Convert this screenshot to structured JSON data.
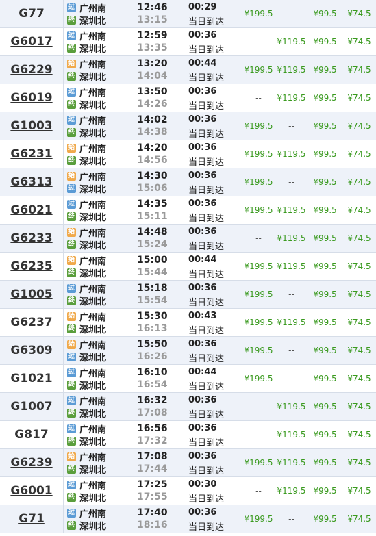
{
  "colors": {
    "row_alt": "#eef2f9",
    "price_green": "#3a9a1f",
    "arrival_grey": "#9a9a9a",
    "badge_pass": "#5b9bd5",
    "badge_start": "#f0a94b",
    "badge_end": "#5a9e3c"
  },
  "badges": {
    "pass": "过",
    "start": "始",
    "end": "终"
  },
  "trains": [
    {
      "no": "G77",
      "from": "广州南",
      "to": "深圳北",
      "from_type": "pass",
      "to_type": "end",
      "dep": "12:46",
      "arr": "13:15",
      "dur": "00:29",
      "note": "当日到达",
      "p1": "¥199.5",
      "p2": "--",
      "p3": "¥99.5",
      "p4": "¥74.5"
    },
    {
      "no": "G6017",
      "from": "广州南",
      "to": "深圳北",
      "from_type": "pass",
      "to_type": "end",
      "dep": "12:59",
      "arr": "13:35",
      "dur": "00:36",
      "note": "当日到达",
      "p1": "--",
      "p2": "¥119.5",
      "p3": "¥99.5",
      "p4": "¥74.5"
    },
    {
      "no": "G6229",
      "from": "广州南",
      "to": "深圳北",
      "from_type": "start",
      "to_type": "end",
      "dep": "13:20",
      "arr": "14:04",
      "dur": "00:44",
      "note": "当日到达",
      "p1": "¥199.5",
      "p2": "¥119.5",
      "p3": "¥99.5",
      "p4": "¥74.5"
    },
    {
      "no": "G6019",
      "from": "广州南",
      "to": "深圳北",
      "from_type": "pass",
      "to_type": "end",
      "dep": "13:50",
      "arr": "14:26",
      "dur": "00:36",
      "note": "当日到达",
      "p1": "--",
      "p2": "¥119.5",
      "p3": "¥99.5",
      "p4": "¥74.5"
    },
    {
      "no": "G1003",
      "from": "广州南",
      "to": "深圳北",
      "from_type": "pass",
      "to_type": "end",
      "dep": "14:02",
      "arr": "14:38",
      "dur": "00:36",
      "note": "当日到达",
      "p1": "¥199.5",
      "p2": "--",
      "p3": "¥99.5",
      "p4": "¥74.5"
    },
    {
      "no": "G6231",
      "from": "广州南",
      "to": "深圳北",
      "from_type": "start",
      "to_type": "end",
      "dep": "14:20",
      "arr": "14:56",
      "dur": "00:36",
      "note": "当日到达",
      "p1": "¥199.5",
      "p2": "¥119.5",
      "p3": "¥99.5",
      "p4": "¥74.5"
    },
    {
      "no": "G6313",
      "from": "广州南",
      "to": "深圳北",
      "from_type": "start",
      "to_type": "pass",
      "dep": "14:30",
      "arr": "15:06",
      "dur": "00:36",
      "note": "当日到达",
      "p1": "¥199.5",
      "p2": "--",
      "p3": "¥99.5",
      "p4": "¥74.5"
    },
    {
      "no": "G6021",
      "from": "广州南",
      "to": "深圳北",
      "from_type": "pass",
      "to_type": "end",
      "dep": "14:35",
      "arr": "15:11",
      "dur": "00:36",
      "note": "当日到达",
      "p1": "¥199.5",
      "p2": "¥119.5",
      "p3": "¥99.5",
      "p4": "¥74.5"
    },
    {
      "no": "G6233",
      "from": "广州南",
      "to": "深圳北",
      "from_type": "start",
      "to_type": "end",
      "dep": "14:48",
      "arr": "15:24",
      "dur": "00:36",
      "note": "当日到达",
      "p1": "--",
      "p2": "¥119.5",
      "p3": "¥99.5",
      "p4": "¥74.5"
    },
    {
      "no": "G6235",
      "from": "广州南",
      "to": "深圳北",
      "from_type": "start",
      "to_type": "end",
      "dep": "15:00",
      "arr": "15:44",
      "dur": "00:44",
      "note": "当日到达",
      "p1": "¥199.5",
      "p2": "¥119.5",
      "p3": "¥99.5",
      "p4": "¥74.5"
    },
    {
      "no": "G1005",
      "from": "广州南",
      "to": "深圳北",
      "from_type": "pass",
      "to_type": "end",
      "dep": "15:18",
      "arr": "15:54",
      "dur": "00:36",
      "note": "当日到达",
      "p1": "¥199.5",
      "p2": "--",
      "p3": "¥99.5",
      "p4": "¥74.5"
    },
    {
      "no": "G6237",
      "from": "广州南",
      "to": "深圳北",
      "from_type": "start",
      "to_type": "end",
      "dep": "15:30",
      "arr": "16:13",
      "dur": "00:43",
      "note": "当日到达",
      "p1": "¥199.5",
      "p2": "¥119.5",
      "p3": "¥99.5",
      "p4": "¥74.5"
    },
    {
      "no": "G6309",
      "from": "广州南",
      "to": "深圳北",
      "from_type": "start",
      "to_type": "pass",
      "dep": "15:50",
      "arr": "16:26",
      "dur": "00:36",
      "note": "当日到达",
      "p1": "¥199.5",
      "p2": "--",
      "p3": "¥99.5",
      "p4": "¥74.5"
    },
    {
      "no": "G1021",
      "from": "广州南",
      "to": "深圳北",
      "from_type": "pass",
      "to_type": "end",
      "dep": "16:10",
      "arr": "16:54",
      "dur": "00:44",
      "note": "当日到达",
      "p1": "¥199.5",
      "p2": "--",
      "p3": "¥99.5",
      "p4": "¥74.5"
    },
    {
      "no": "G1007",
      "from": "广州南",
      "to": "深圳北",
      "from_type": "pass",
      "to_type": "end",
      "dep": "16:32",
      "arr": "17:08",
      "dur": "00:36",
      "note": "当日到达",
      "p1": "--",
      "p2": "¥119.5",
      "p3": "¥99.5",
      "p4": "¥74.5"
    },
    {
      "no": "G817",
      "from": "广州南",
      "to": "深圳北",
      "from_type": "pass",
      "to_type": "end",
      "dep": "16:56",
      "arr": "17:32",
      "dur": "00:36",
      "note": "当日到达",
      "p1": "--",
      "p2": "¥119.5",
      "p3": "¥99.5",
      "p4": "¥74.5"
    },
    {
      "no": "G6239",
      "from": "广州南",
      "to": "深圳北",
      "from_type": "start",
      "to_type": "end",
      "dep": "17:08",
      "arr": "17:44",
      "dur": "00:36",
      "note": "当日到达",
      "p1": "¥199.5",
      "p2": "¥119.5",
      "p3": "¥99.5",
      "p4": "¥74.5"
    },
    {
      "no": "G6001",
      "from": "广州南",
      "to": "深圳北",
      "from_type": "pass",
      "to_type": "end",
      "dep": "17:25",
      "arr": "17:55",
      "dur": "00:30",
      "note": "当日到达",
      "p1": "--",
      "p2": "¥119.5",
      "p3": "¥99.5",
      "p4": "¥74.5"
    },
    {
      "no": "G71",
      "from": "广州南",
      "to": "深圳北",
      "from_type": "pass",
      "to_type": "end",
      "dep": "17:40",
      "arr": "18:16",
      "dur": "00:36",
      "note": "当日到达",
      "p1": "¥199.5",
      "p2": "--",
      "p3": "¥99.5",
      "p4": "¥74.5"
    }
  ]
}
